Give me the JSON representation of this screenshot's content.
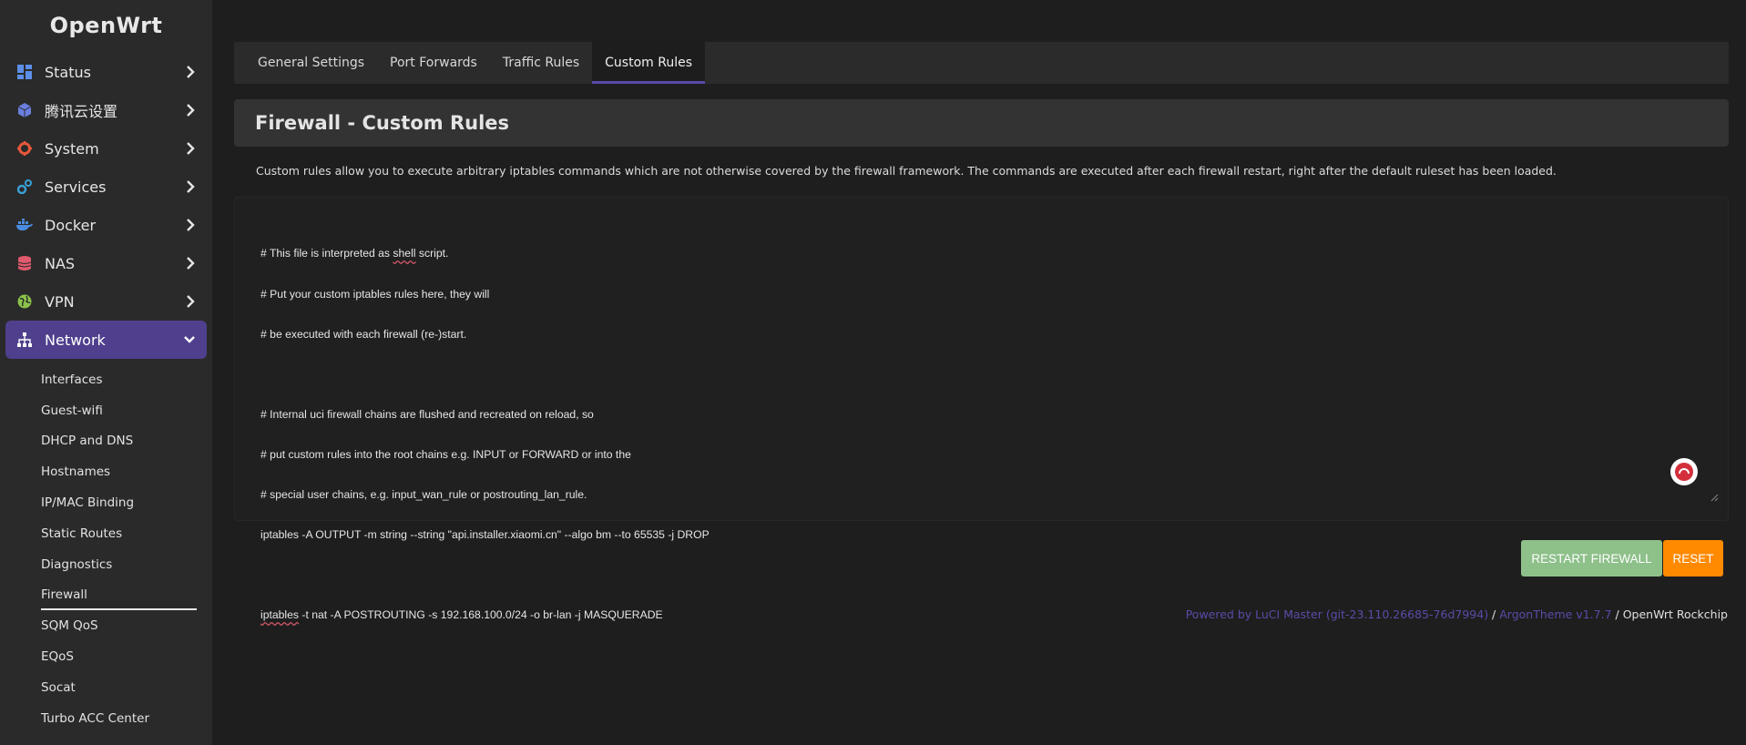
{
  "app": {
    "logo": "OpenWrt"
  },
  "sidebar": {
    "items": [
      {
        "label": "Status",
        "icon": "dashboard-icon",
        "color": "#5c8ee6"
      },
      {
        "label": "腾讯云设置",
        "icon": "cube-icon",
        "color": "#6a7fe0"
      },
      {
        "label": "System",
        "icon": "gear-icon",
        "color": "#e8573c"
      },
      {
        "label": "Services",
        "icon": "services-icon",
        "color": "#3aa0d8"
      },
      {
        "label": "Docker",
        "icon": "docker-icon",
        "color": "#4a8de0"
      },
      {
        "label": "NAS",
        "icon": "database-icon",
        "color": "#e05a6e"
      },
      {
        "label": "VPN",
        "icon": "globe-icon",
        "color": "#8bc34a"
      },
      {
        "label": "Network",
        "icon": "sitemap-icon",
        "color": "#ffffff"
      }
    ],
    "network_sub": [
      "Interfaces",
      "Guest-wifi",
      "DHCP and DNS",
      "Hostnames",
      "IP/MAC Binding",
      "Static Routes",
      "Diagnostics",
      "Firewall",
      "SQM QoS",
      "EQoS",
      "Socat",
      "Turbo ACC Center"
    ]
  },
  "tabs": [
    "General Settings",
    "Port Forwards",
    "Traffic Rules",
    "Custom Rules"
  ],
  "page": {
    "title": "Firewall - Custom Rules",
    "description": "Custom rules allow you to execute arbitrary iptables commands which are not otherwise covered by the firewall framework. The commands are executed after each firewall restart, right after the default ruleset has been loaded."
  },
  "editor": {
    "lines": [
      "# This file is interpreted as shell script.",
      "# Put your custom iptables rules here, they will",
      "# be executed with each firewall (re-)start.",
      "",
      "# Internal uci firewall chains are flushed and recreated on reload, so",
      "# put custom rules into the root chains e.g. INPUT or FORWARD or into the",
      "# special user chains, e.g. input_wan_rule or postrouting_lan_rule.",
      "iptables -A OUTPUT -m string --string \"api.installer.xiaomi.cn\" --algo bm --to 65535 -j DROP",
      "",
      "iptables -t nat -A POSTROUTING -s 192.168.100.0/24 -o br-lan -j MASQUERADE"
    ]
  },
  "buttons": {
    "restart": "RESTART FIREWALL",
    "reset": "RESET"
  },
  "footer": {
    "luci": "Powered by LuCI Master (git-23.110.26685-76d7994)",
    "sep1": " / ",
    "theme": "ArgonTheme v1.7.7",
    "sep2": " / ",
    "device": "OpenWrt Rockchip"
  },
  "colors": {
    "accent": "#4f3f8d",
    "restart_btn": "#8ec08a",
    "reset_btn": "#ff8a00",
    "link": "#5b4ba8"
  }
}
